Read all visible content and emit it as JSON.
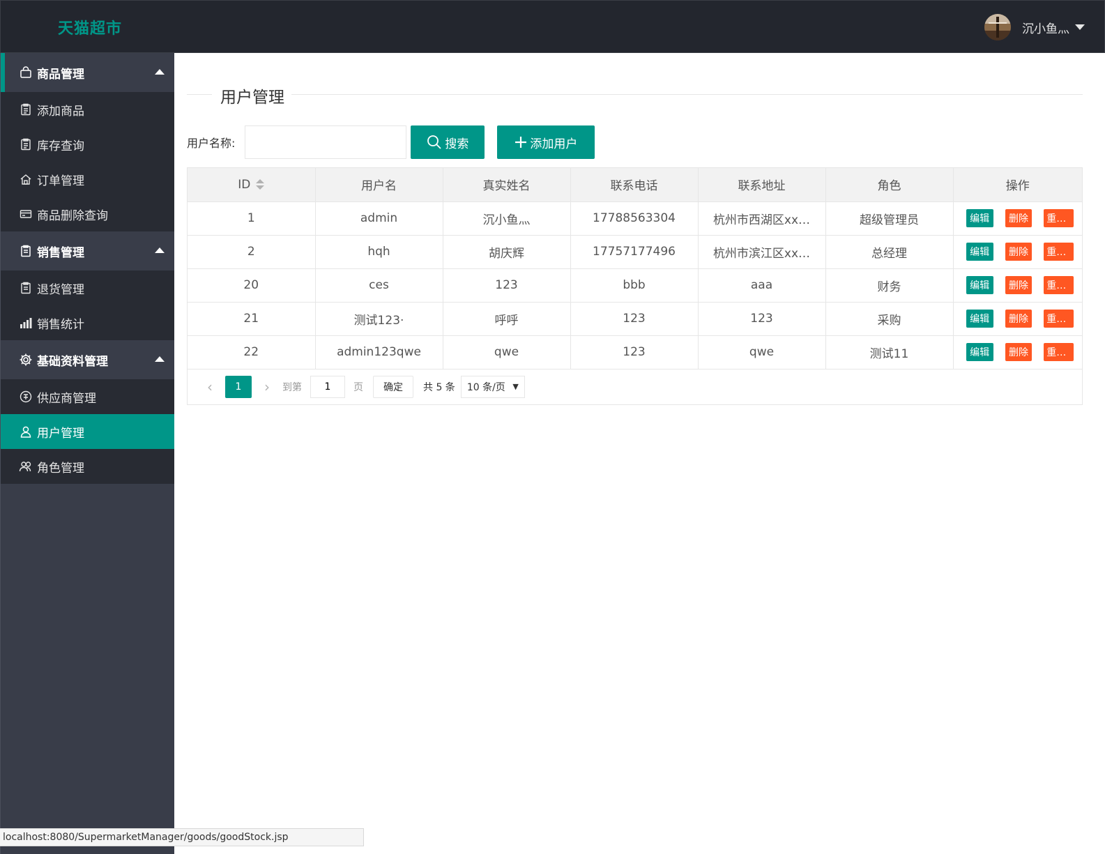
{
  "header": {
    "logo": "天猫超市",
    "user_name": "沉小鱼灬"
  },
  "sidebar": {
    "groups": [
      {
        "title": "商品管理",
        "icon": "basket-icon",
        "items": [
          {
            "label": "添加商品",
            "icon": "clipboard-icon"
          },
          {
            "label": "库存查询",
            "icon": "clipboard-icon"
          },
          {
            "label": "订单管理",
            "icon": "home-icon"
          },
          {
            "label": "商品删除查询",
            "icon": "card-icon"
          }
        ]
      },
      {
        "title": "销售管理",
        "icon": "clipboard-icon",
        "items": [
          {
            "label": "退货管理",
            "icon": "clipboard-icon"
          },
          {
            "label": "销售统计",
            "icon": "bar-chart-icon"
          }
        ]
      },
      {
        "title": "基础资料管理",
        "icon": "gear-icon",
        "items": [
          {
            "label": "供应商管理",
            "icon": "supplier-icon"
          },
          {
            "label": "用户管理",
            "icon": "user-icon",
            "active": true
          },
          {
            "label": "角色管理",
            "icon": "users-icon"
          }
        ]
      }
    ]
  },
  "main": {
    "title": "用户管理",
    "search": {
      "label": "用户名称:",
      "value": "",
      "placeholder": "",
      "search_button": "搜索",
      "add_button": "添加用户"
    },
    "table": {
      "columns": [
        "ID",
        "用户名",
        "真实姓名",
        "联系电话",
        "联系地址",
        "角色",
        "操作"
      ],
      "rows": [
        {
          "id": "1",
          "username": "admin",
          "realname": "沉小鱼灬",
          "phone": "17788563304",
          "address": "杭州市西湖区xx…",
          "role": "超级管理员"
        },
        {
          "id": "2",
          "username": "hqh",
          "realname": "胡庆辉",
          "phone": "17757177496",
          "address": "杭州市滨江区xx…",
          "role": "总经理"
        },
        {
          "id": "20",
          "username": "ces",
          "realname": "123",
          "phone": "bbb",
          "address": "aaa",
          "role": "财务"
        },
        {
          "id": "21",
          "username": "测试123·",
          "realname": "呼呼",
          "phone": "123",
          "address": "123",
          "role": "采购"
        },
        {
          "id": "22",
          "username": "admin123qwe",
          "realname": "qwe",
          "phone": "123",
          "address": "qwe",
          "role": "测试11"
        }
      ],
      "actions": {
        "edit": "编辑",
        "delete": "删除",
        "reset": "重…"
      }
    },
    "pager": {
      "current_page": "1",
      "goto_label": "到第",
      "goto_value": "1",
      "page_label": "页",
      "confirm": "确定",
      "total": "共 5 条",
      "page_size": "10 条/页"
    }
  },
  "statusbar": {
    "url": "localhost:8080/SupermarketManager/goods/goodStock.jsp"
  },
  "colors": {
    "accent": "#009688",
    "danger": "#ff5722",
    "header_bg": "#23262e",
    "sidebar_bg": "#393d49",
    "sidebar_sub_bg": "#282b33"
  }
}
